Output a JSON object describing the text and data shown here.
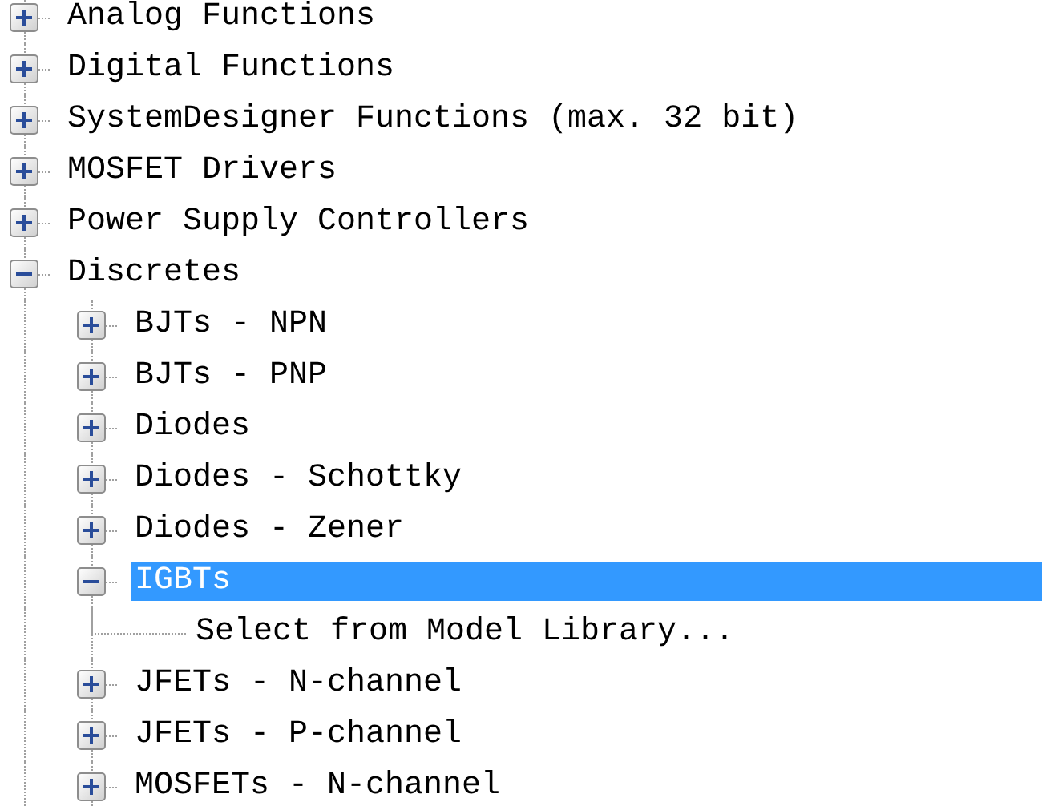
{
  "tree": {
    "items": [
      {
        "label": "Analog Functions",
        "kind": "folder",
        "expanded": false,
        "selected": false
      },
      {
        "label": "Digital Functions",
        "kind": "folder",
        "expanded": false,
        "selected": false
      },
      {
        "label": "SystemDesigner Functions (max. 32 bit)",
        "kind": "folder",
        "expanded": false,
        "selected": false
      },
      {
        "label": "MOSFET Drivers",
        "kind": "folder",
        "expanded": false,
        "selected": false
      },
      {
        "label": "Power Supply Controllers",
        "kind": "folder",
        "expanded": false,
        "selected": false
      },
      {
        "label": "Discretes",
        "kind": "folder",
        "expanded": true,
        "selected": false,
        "children": [
          {
            "label": "BJTs - NPN",
            "kind": "folder",
            "expanded": false,
            "selected": false
          },
          {
            "label": "BJTs - PNP",
            "kind": "folder",
            "expanded": false,
            "selected": false
          },
          {
            "label": "Diodes",
            "kind": "folder",
            "expanded": false,
            "selected": false
          },
          {
            "label": "Diodes - Schottky",
            "kind": "folder",
            "expanded": false,
            "selected": false
          },
          {
            "label": "Diodes - Zener",
            "kind": "folder",
            "expanded": false,
            "selected": false
          },
          {
            "label": "IGBTs",
            "kind": "folder",
            "expanded": true,
            "selected": true,
            "children": [
              {
                "label": "Select from Model Library...",
                "kind": "leaf",
                "selected": false
              }
            ]
          },
          {
            "label": "JFETs - N-channel",
            "kind": "folder",
            "expanded": false,
            "selected": false
          },
          {
            "label": "JFETs - P-channel",
            "kind": "folder",
            "expanded": false,
            "selected": false
          },
          {
            "label": "MOSFETs - N-channel",
            "kind": "folder",
            "expanded": false,
            "selected": false
          }
        ]
      }
    ]
  }
}
